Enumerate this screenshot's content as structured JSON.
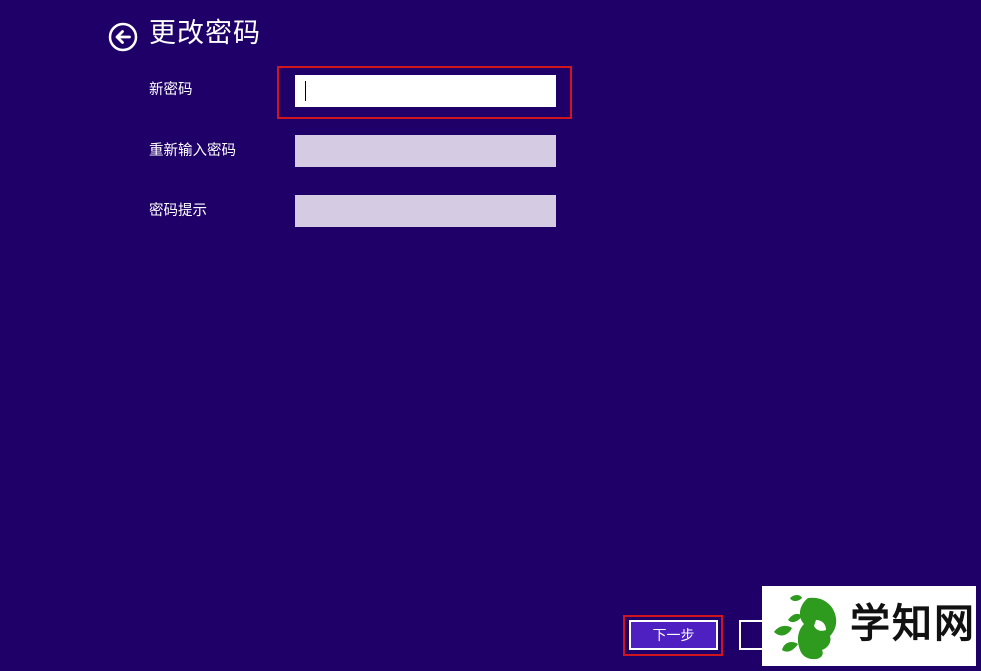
{
  "header": {
    "title": "更改密码",
    "back_icon": "back-arrow-icon"
  },
  "form": {
    "fields": [
      {
        "label": "新密码",
        "value": "",
        "placeholder": "",
        "focused": true
      },
      {
        "label": "重新输入密码",
        "value": "",
        "placeholder": "",
        "focused": false
      },
      {
        "label": "密码提示",
        "value": "",
        "placeholder": "",
        "focused": false
      }
    ]
  },
  "footer": {
    "next_label": "下一步",
    "cancel_label": ""
  },
  "watermark": {
    "text": "学知网",
    "logo_icon": "leaf-head-logo-icon"
  },
  "colors": {
    "background": "#1f0068",
    "highlight": "#d0151f",
    "next_button": "#4e20c2",
    "input_inactive": "#d5cce4",
    "input_active": "#ffffff",
    "logo_green": "#2e9a1e"
  }
}
